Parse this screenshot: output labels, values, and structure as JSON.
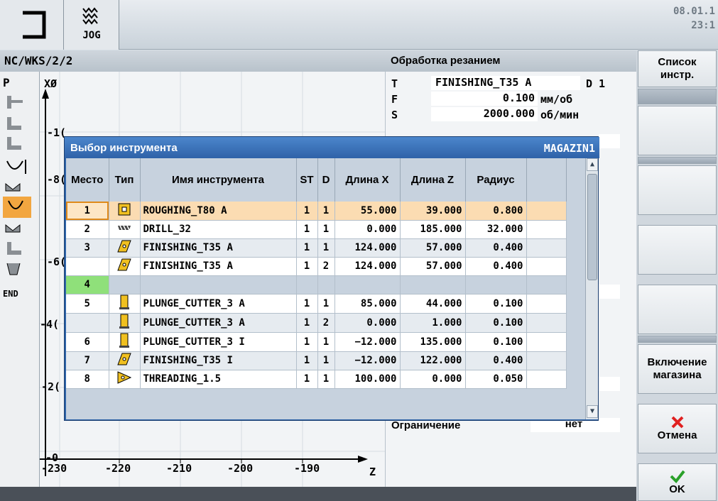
{
  "header": {
    "mode_label": "JOG",
    "date": "08.01.1",
    "time": "23:1"
  },
  "channel": {
    "path": "NC/WKS/2/2",
    "operation_title": "Обработка резанием"
  },
  "left_col": {
    "items": [
      "P",
      "END"
    ]
  },
  "plot": {
    "x_axis_label": "Z",
    "y_axis_label": "XØ",
    "x_ticks": [
      "-230",
      "-220",
      "-210",
      "-200",
      "-190"
    ],
    "y_ticks": [
      "-1(",
      "-8(",
      "-6(",
      "-4(",
      "-2(",
      "-0"
    ]
  },
  "params": {
    "t_label": "T",
    "t_value": "FINISHING_T35 A",
    "d_label": "D 1",
    "f_label": "F",
    "f_value": "0.100",
    "f_unit": "мм/об",
    "s_label": "S",
    "s_value": "2000.000",
    "s_unit": "об/мин",
    "limit_label": "Ограничение",
    "limit_value": "нет"
  },
  "dialog": {
    "title": "Выбор инструмента",
    "magazine": "MAGAZIN1",
    "columns": [
      "Место",
      "Тип",
      "Имя инструмента",
      "ST",
      "D",
      "Длина X",
      "Длина Z",
      "Радиус"
    ],
    "rows": [
      {
        "place": "1",
        "icon": "roughing-tool-icon",
        "name": "ROUGHING_T80 A",
        "st": "1",
        "d": "1",
        "len_x": "55.000",
        "len_z": "39.000",
        "radius": "0.800"
      },
      {
        "place": "2",
        "icon": "drill-tool-icon",
        "name": "DRILL_32",
        "st": "1",
        "d": "1",
        "len_x": "0.000",
        "len_z": "185.000",
        "radius": "32.000"
      },
      {
        "place": "3",
        "icon": "finishing-tool-icon",
        "name": "FINISHING_T35 A",
        "st": "1",
        "d": "1",
        "len_x": "124.000",
        "len_z": "57.000",
        "radius": "0.400"
      },
      {
        "place": "",
        "icon": "finishing-tool-icon",
        "name": "FINISHING_T35 A",
        "st": "1",
        "d": "2",
        "len_x": "124.000",
        "len_z": "57.000",
        "radius": "0.400"
      },
      {
        "place": "4",
        "icon": "",
        "name": "",
        "st": "",
        "d": "",
        "len_x": "",
        "len_z": "",
        "radius": ""
      },
      {
        "place": "5",
        "icon": "plunge-cutter-icon",
        "name": "PLUNGE_CUTTER_3 A",
        "st": "1",
        "d": "1",
        "len_x": "85.000",
        "len_z": "44.000",
        "radius": "0.100"
      },
      {
        "place": "",
        "icon": "plunge-cutter-icon",
        "name": "PLUNGE_CUTTER_3 A",
        "st": "1",
        "d": "2",
        "len_x": "0.000",
        "len_z": "1.000",
        "radius": "0.100"
      },
      {
        "place": "6",
        "icon": "plunge-cutter-icon",
        "name": "PLUNGE_CUTTER_3 I",
        "st": "1",
        "d": "1",
        "len_x": "−12.000",
        "len_z": "135.000",
        "radius": "0.100"
      },
      {
        "place": "7",
        "icon": "finishing-tool-icon",
        "name": "FINISHING_T35 I",
        "st": "1",
        "d": "1",
        "len_x": "−12.000",
        "len_z": "122.000",
        "radius": "0.400"
      },
      {
        "place": "8",
        "icon": "threading-tool-icon",
        "name": "THREADING_1.5",
        "st": "1",
        "d": "1",
        "len_x": "100.000",
        "len_z": "0.000",
        "radius": "0.050"
      }
    ]
  },
  "softkeys": {
    "tool_list_1": "Список",
    "tool_list_2": "инстр.",
    "magazine_1": "Включение",
    "magazine_2": "магазина",
    "cancel": "Отмена",
    "ok": "OK"
  },
  "colors": {
    "dialog_blue": "#2d63a8",
    "selection_row": "#fbdcb2",
    "empty_place": "#8fe07a",
    "cancel_red": "#e02020",
    "ok_green": "#2aa02a"
  }
}
